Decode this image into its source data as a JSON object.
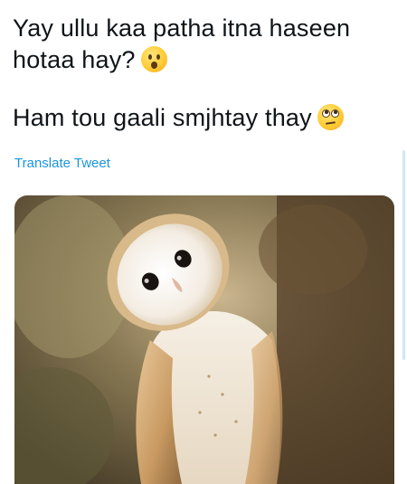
{
  "tweet": {
    "line1": "Yay ullu kaa patha itna haseen",
    "line2": "hotaa hay?",
    "line2_emoji": "hushed-face-icon",
    "line3": "Ham tou gaali smjhtay thay",
    "line3_emoji": "face-with-rolling-eyes-icon",
    "translate_label": "Translate Tweet"
  },
  "media": {
    "subject": "barn-owl-photo"
  },
  "colors": {
    "text": "#0f1419",
    "link": "#1b95e0",
    "background": "#ffffff"
  }
}
